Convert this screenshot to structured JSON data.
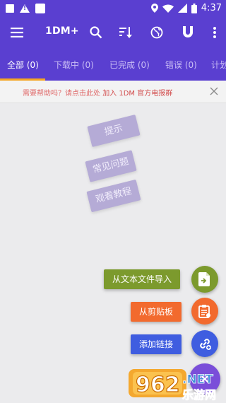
{
  "status_bar": {
    "time": "4:37"
  },
  "app_bar": {
    "title": "1DM+"
  },
  "tabs": [
    {
      "label": "全部 (0)"
    },
    {
      "label": "下载中 (0)"
    },
    {
      "label": "已完成 (0)"
    },
    {
      "label": "错误 (0)"
    },
    {
      "label": "计划"
    }
  ],
  "banner": {
    "text": "需要帮助吗？请点击此处",
    "link_text": "加入 1DM 官方电报群"
  },
  "hints": {
    "tip": "提示",
    "faq": "常见问题",
    "tutorial": "观看教程"
  },
  "fab_menu": {
    "import_text": "从文本文件导入",
    "from_clipboard": "从剪贴板",
    "add_link": "添加链接"
  },
  "watermark": {
    "text_number": "962",
    "text_suffix": ".NET",
    "text_cn": "乐游网"
  },
  "colors": {
    "primary": "#5a3fd0",
    "accent_tab": "#f5a623",
    "import_green": "#7c9a2d",
    "clipboard_orange": "#f26a2e",
    "link_blue": "#3f5de0",
    "banner_red": "#e06c6c"
  },
  "icons": {
    "menu": "menu-icon",
    "search": "search-icon",
    "sort": "sort-icon",
    "globe": "globe-icon",
    "magnet": "magnet-icon",
    "more": "more-vert-icon"
  }
}
